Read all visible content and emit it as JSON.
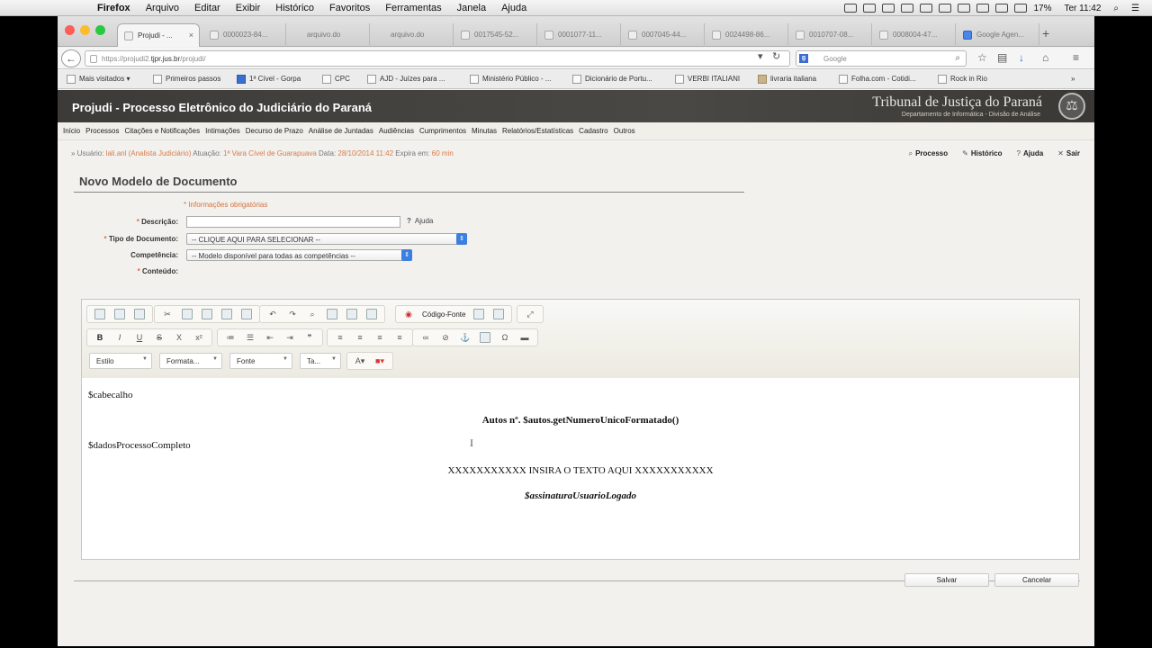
{
  "mac_menubar": {
    "items": [
      "Firefox",
      "Arquivo",
      "Editar",
      "Exibir",
      "Histórico",
      "Favoritos",
      "Ferramentas",
      "Janela",
      "Ajuda"
    ],
    "battery": "17%",
    "clock": "Ter 11:42"
  },
  "browser": {
    "tabs": [
      {
        "label": "Projudi - ...",
        "active": true
      },
      {
        "label": "0000023-84..."
      },
      {
        "label": "arquivo.do"
      },
      {
        "label": "arquivo.do"
      },
      {
        "label": "0017545-52..."
      },
      {
        "label": "0001077-11..."
      },
      {
        "label": "0007045-44..."
      },
      {
        "label": "0024498-86..."
      },
      {
        "label": "0010707-08..."
      },
      {
        "label": "0008004-47..."
      },
      {
        "label": "Google Agen..."
      }
    ],
    "close_tab": "×",
    "new_tab": "+",
    "back": "←",
    "url_prefix": "https://projudi2.",
    "url_host": "tjpr.jus.br",
    "url_path": "/projudi/",
    "search_engine_badge": "g",
    "search_placeholder": "Google",
    "bookmarks": [
      {
        "label": "Mais visitados",
        "icon": "bookmarks-icon"
      },
      {
        "label": "Primeiros passos",
        "icon": "page-icon"
      },
      {
        "label": "1ª Cível - Gorpa",
        "icon": "blue-icon"
      },
      {
        "label": "CPC",
        "icon": "page-icon"
      },
      {
        "label": "AJD - Juízes para ...",
        "icon": "page-icon"
      },
      {
        "label": "Ministério Público - ...",
        "icon": "page-icon"
      },
      {
        "label": "Dicionário de Portu...",
        "icon": "page-icon"
      },
      {
        "label": "VERBI ITALIANI",
        "icon": "page-icon"
      },
      {
        "label": "livraria italiana",
        "icon": "tan-icon"
      },
      {
        "label": "Folha.com - Cotidi...",
        "icon": "page-icon"
      },
      {
        "label": "Rock in Rio",
        "icon": "page-icon"
      }
    ]
  },
  "header": {
    "title": "Projudi - Processo Eletrônico do Judiciário do Paraná",
    "court_name": "Tribunal de Justiça do Paraná",
    "court_sub": "Departamento de Informática - Divisão de Análise"
  },
  "nav_menu": [
    "Início",
    "Processos",
    "Citações e Notificações",
    "Intimações",
    "Decurso de Prazo",
    "Análise de Juntadas",
    "Audiências",
    "Cumprimentos",
    "Minutas",
    "Relatórios/Estatísticas",
    "Cadastro",
    "Outros"
  ],
  "user_info": {
    "user_label": "Usuário:",
    "user_value": "lali.anl (Analista Judiciário)",
    "atuacao_label": "Atuação:",
    "atuacao_value": "1ª Vara Cível de Guarapuava",
    "data_label": "Data:",
    "data_value": "28/10/2014 11:42",
    "expira_label": "Expira em:",
    "expira_value": "60 min"
  },
  "top_links": [
    "Processo",
    "Histórico",
    "Ajuda",
    "Sair"
  ],
  "form": {
    "section_title": "Novo Modelo de Documento",
    "required_note": "* Informações obrigatórias",
    "descricao_label": "Descrição:",
    "descricao_value": "",
    "ajuda_label": "Ajuda",
    "tipo_label": "Tipo de Documento:",
    "tipo_value": "-- CLIQUE AQUI PARA SELECIONAR --",
    "competencia_label": "Competência:",
    "competencia_value": "-- Modelo disponível para todas as competências --",
    "conteudo_label": "Conteúdo:"
  },
  "editor": {
    "source_button": "Código-Fonte",
    "format_buttons": [
      "B",
      "I",
      "U",
      "S",
      "X",
      "x²"
    ],
    "combos": [
      "Estilo",
      "Formata...",
      "Fonte",
      "Ta..."
    ],
    "content": {
      "line1": "$cabecalho",
      "line2": "Autos nº. $autos.getNumeroUnicoFormatado()",
      "line3": "$dadosProcessoCompleto",
      "line4": "XXXXXXXXXXX INSIRA O TEXTO AQUI XXXXXXXXXXX",
      "line5": "$assinaturaUsuarioLogado"
    }
  },
  "buttons": {
    "save": "Salvar",
    "cancel": "Cancelar"
  }
}
